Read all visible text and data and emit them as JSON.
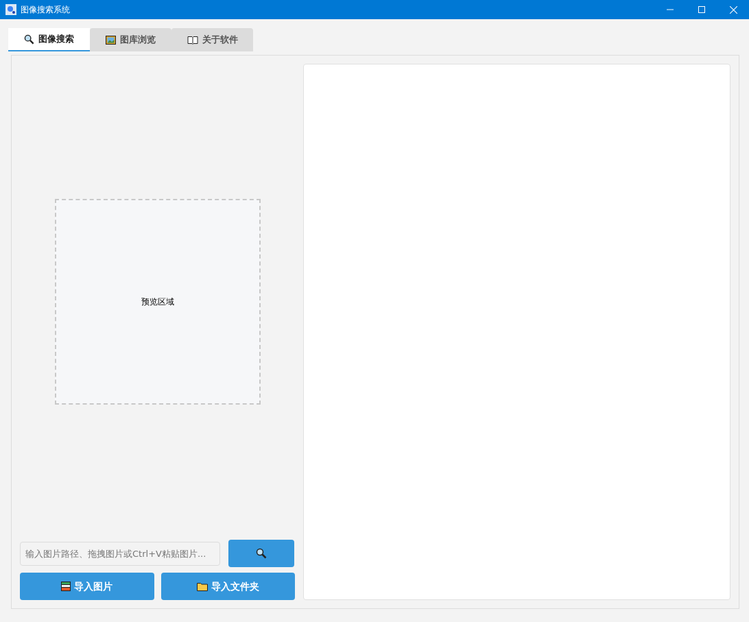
{
  "window": {
    "title": "图像搜索系统"
  },
  "tabs": [
    {
      "label": "图像搜索",
      "selected": true
    },
    {
      "label": "图库浏览",
      "selected": false
    },
    {
      "label": "关于软件",
      "selected": false
    }
  ],
  "preview": {
    "label": "预览区域"
  },
  "path_field": {
    "placeholder": "输入图片路径、拖拽图片或Ctrl+V粘贴图片..."
  },
  "buttons": [
    {
      "label": "导入图片"
    },
    {
      "label": "导入文件夹"
    }
  ]
}
